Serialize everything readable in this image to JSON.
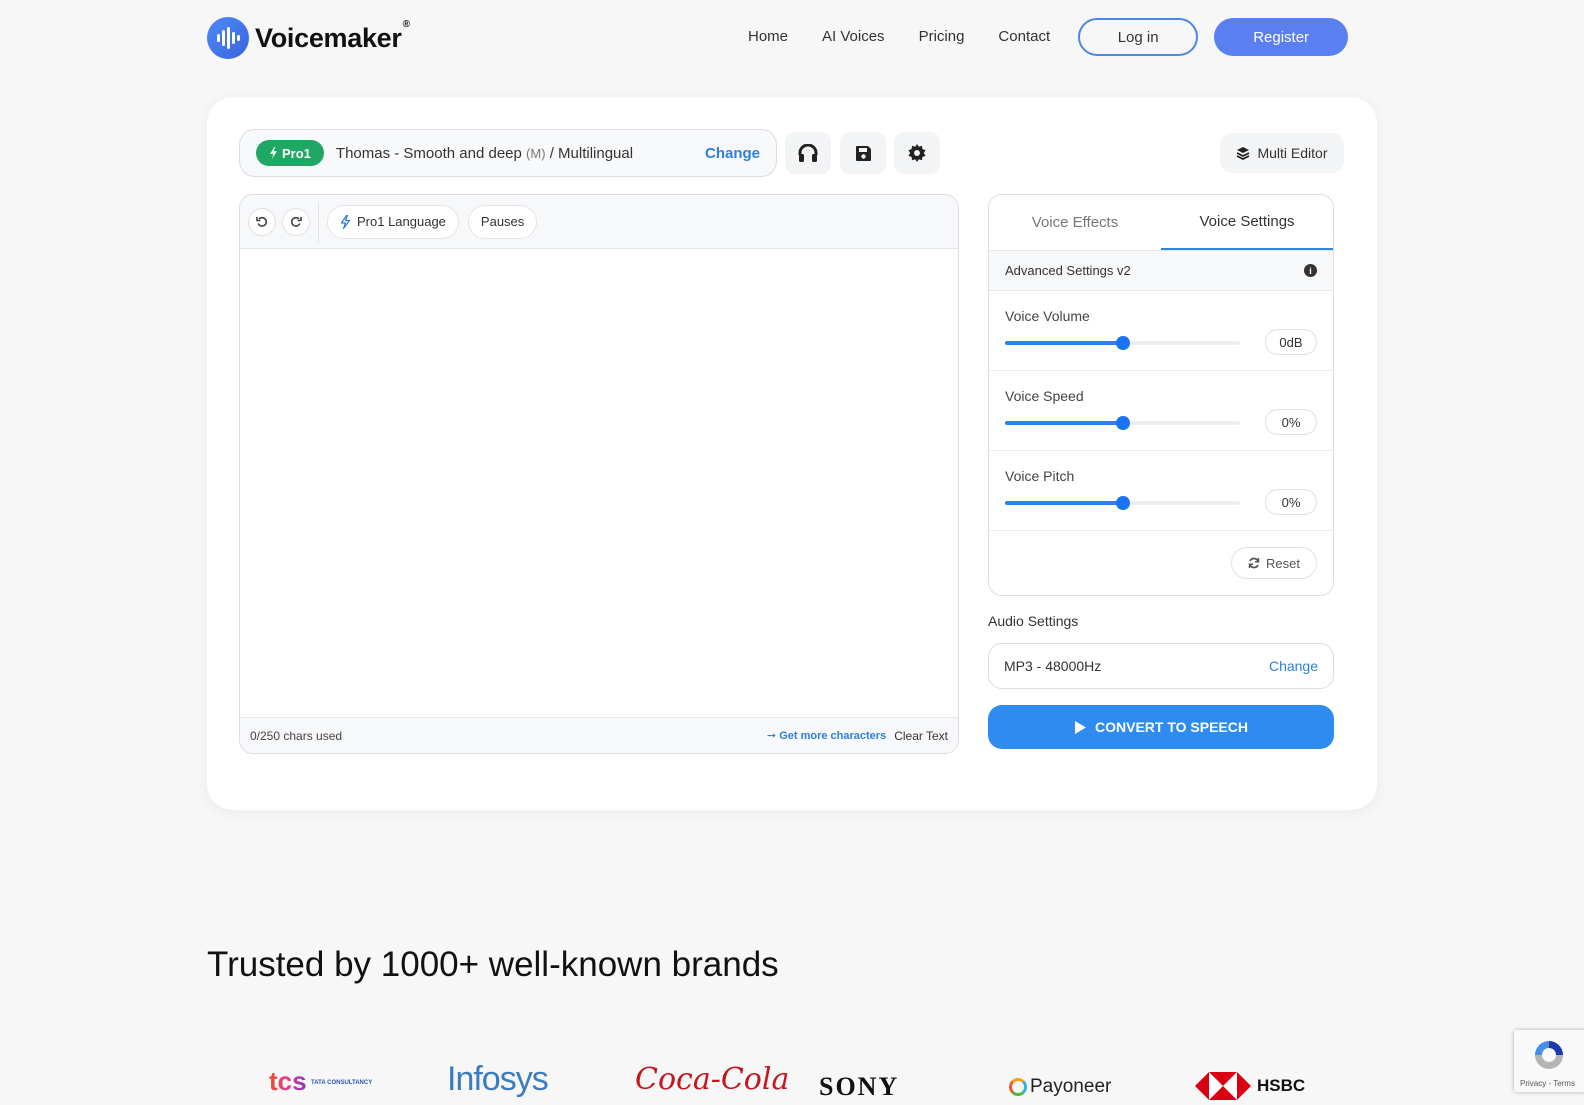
{
  "header": {
    "brand_name": "Voicemaker",
    "brand_reg": "®",
    "nav": [
      "Home",
      "AI Voices",
      "Pricing",
      "Contact"
    ],
    "login_label": "Log in",
    "register_label": "Register"
  },
  "voice": {
    "badge": "Pro1",
    "name": "Thomas - Smooth and deep",
    "gender": "(M)",
    "language": "/ Multilingual",
    "change_label": "Change"
  },
  "toolbar": {
    "icons": [
      "headphones-icon",
      "save-icon",
      "settings-icon"
    ],
    "multi_editor_label": "Multi Editor"
  },
  "editor": {
    "pro_language_label": "Pro1 Language",
    "pauses_label": "Pauses",
    "text": "",
    "chars_used": "0/250 chars used",
    "get_more_label": "Get more characters",
    "clear_text_label": "Clear Text"
  },
  "settings": {
    "tabs": [
      {
        "label": "Voice Effects",
        "active": false
      },
      {
        "label": "Voice Settings",
        "active": true
      }
    ],
    "advanced_label": "Advanced Settings v2",
    "sliders": [
      {
        "label": "Voice Volume",
        "value": "0dB",
        "position": 0.5
      },
      {
        "label": "Voice Speed",
        "value": "0%",
        "position": 0.5
      },
      {
        "label": "Voice Pitch",
        "value": "0%",
        "position": 0.5
      }
    ],
    "reset_label": "Reset"
  },
  "audio": {
    "label": "Audio Settings",
    "format": "MP3 - 48000Hz",
    "change_label": "Change"
  },
  "convert_label": "CONVERT TO SPEECH",
  "trusted": {
    "title": "Trusted by 1000+ well-known brands",
    "brands": [
      "tcs",
      "Infosys",
      "Coca-Cola",
      "SONY",
      "Payoneer",
      "HSBC"
    ],
    "tcs_sub": "TATA CONSULTANCY"
  },
  "recaptcha": {
    "text": "Privacy - Terms"
  },
  "colors": {
    "accent": "#2e8cf1",
    "register": "#5a7ff0",
    "pro_badge": "#1fa863"
  }
}
